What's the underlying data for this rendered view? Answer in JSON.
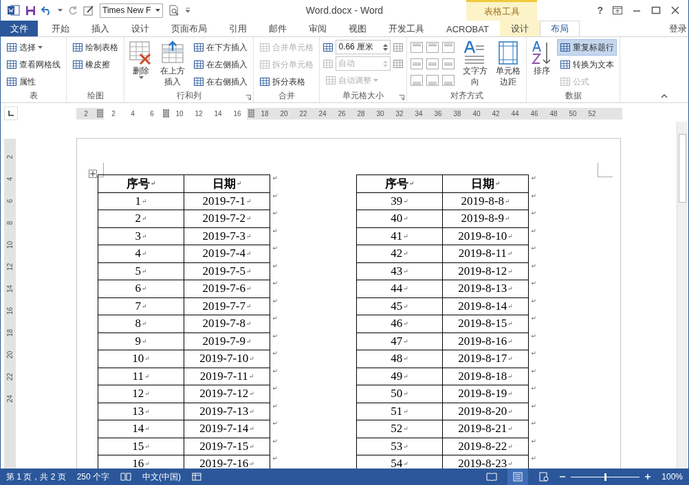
{
  "window": {
    "title": "Word.docx - Word",
    "help": "?",
    "sign_in": "登录",
    "contextual_header": "表格工具"
  },
  "quick_access": {
    "font": "Times New F"
  },
  "tabs": [
    {
      "label": "文件",
      "kind": "file",
      "selected": false
    },
    {
      "label": "开始",
      "kind": "normal",
      "selected": false
    },
    {
      "label": "插入",
      "kind": "normal",
      "selected": false
    },
    {
      "label": "设计",
      "kind": "normal",
      "selected": false
    },
    {
      "label": "页面布局",
      "kind": "normal",
      "selected": false
    },
    {
      "label": "引用",
      "kind": "normal",
      "selected": false
    },
    {
      "label": "邮件",
      "kind": "normal",
      "selected": false
    },
    {
      "label": "审阅",
      "kind": "normal",
      "selected": false
    },
    {
      "label": "视图",
      "kind": "normal",
      "selected": false
    },
    {
      "label": "开发工具",
      "kind": "normal",
      "selected": false
    },
    {
      "label": "ACROBAT",
      "kind": "normal",
      "selected": false
    },
    {
      "label": "设计",
      "kind": "context",
      "selected": false
    },
    {
      "label": "布局",
      "kind": "context",
      "selected": true
    }
  ],
  "ribbon": [
    {
      "label": "表",
      "launcher": false,
      "items": [
        {
          "kind": "stack",
          "buttons": [
            {
              "label": "选择",
              "dropdown": true,
              "disabled": false,
              "selected": false
            },
            {
              "label": "查看网格线",
              "dropdown": false,
              "disabled": false,
              "selected": false
            },
            {
              "label": "属性",
              "dropdown": false,
              "disabled": false,
              "selected": false
            }
          ]
        }
      ]
    },
    {
      "label": "绘图",
      "launcher": false,
      "items": [
        {
          "kind": "stack",
          "buttons": [
            {
              "label": "绘制表格",
              "dropdown": false,
              "disabled": false,
              "selected": false
            },
            {
              "label": "橡皮擦",
              "dropdown": false,
              "disabled": false,
              "selected": false
            }
          ]
        }
      ]
    },
    {
      "label": "行和列",
      "launcher": true,
      "items": [
        {
          "kind": "large",
          "label": "删除",
          "dropdown": true
        },
        {
          "kind": "large",
          "label": "在上方插入",
          "dropdown": false
        },
        {
          "kind": "stack",
          "buttons": [
            {
              "label": "在下方插入",
              "dropdown": false,
              "disabled": false,
              "selected": false
            },
            {
              "label": "在左侧插入",
              "dropdown": false,
              "disabled": false,
              "selected": false
            },
            {
              "label": "在右侧插入",
              "dropdown": false,
              "disabled": false,
              "selected": false
            }
          ]
        }
      ]
    },
    {
      "label": "合并",
      "launcher": false,
      "items": [
        {
          "kind": "stack",
          "buttons": [
            {
              "label": "合并单元格",
              "dropdown": false,
              "disabled": true,
              "selected": false
            },
            {
              "label": "拆分单元格",
              "dropdown": false,
              "disabled": true,
              "selected": false
            },
            {
              "label": "拆分表格",
              "dropdown": false,
              "disabled": false,
              "selected": false
            }
          ]
        }
      ]
    },
    {
      "label": "单元格大小",
      "launcher": true,
      "items": [
        {
          "kind": "sizes",
          "height": "0.66 厘米",
          "width": "自动",
          "width_disabled": true,
          "autofit": "自动调整",
          "autofit_disabled": true
        }
      ]
    },
    {
      "label": "对齐方式",
      "launcher": false,
      "items": [
        {
          "kind": "align"
        },
        {
          "kind": "large",
          "label": "文字方向",
          "dropdown": false
        },
        {
          "kind": "large",
          "label": "单元格边距",
          "dropdown": false
        }
      ]
    },
    {
      "label": "数据",
      "launcher": false,
      "items": [
        {
          "kind": "large",
          "label": "排序",
          "dropdown": false
        },
        {
          "kind": "stack",
          "buttons": [
            {
              "label": "重复标题行",
              "dropdown": false,
              "disabled": false,
              "selected": true
            },
            {
              "label": "转换为文本",
              "dropdown": false,
              "disabled": false,
              "selected": false
            },
            {
              "label": "公式",
              "dropdown": false,
              "disabled": true,
              "selected": false
            }
          ]
        }
      ]
    }
  ],
  "ruler": [
    {
      "kind": "num",
      "text": "2",
      "margin": true
    },
    {
      "kind": "marker",
      "margin": true
    },
    {
      "kind": "num",
      "text": "2",
      "margin": false
    },
    {
      "kind": "num",
      "text": "4",
      "margin": false
    },
    {
      "kind": "num",
      "text": "6",
      "margin": false
    },
    {
      "kind": "marker",
      "margin": false
    },
    {
      "kind": "num",
      "text": "10",
      "margin": false
    },
    {
      "kind": "num",
      "text": "12",
      "margin": false
    },
    {
      "kind": "num",
      "text": "14",
      "margin": false
    },
    {
      "kind": "num",
      "text": "16",
      "margin": false
    },
    {
      "kind": "marker",
      "margin": true
    },
    {
      "kind": "num",
      "text": "18",
      "margin": true
    },
    {
      "kind": "num",
      "text": "20",
      "margin": true
    },
    {
      "kind": "num",
      "text": "22",
      "margin": true
    },
    {
      "kind": "num",
      "text": "24",
      "margin": true
    },
    {
      "kind": "num",
      "text": "26",
      "margin": true
    },
    {
      "kind": "num",
      "text": "28",
      "margin": true
    },
    {
      "kind": "num",
      "text": "30",
      "margin": true
    },
    {
      "kind": "num",
      "text": "32",
      "margin": true
    },
    {
      "kind": "num",
      "text": "34",
      "margin": true
    },
    {
      "kind": "num",
      "text": "36",
      "margin": true
    },
    {
      "kind": "num",
      "text": "38",
      "margin": true
    },
    {
      "kind": "num",
      "text": "40",
      "margin": true
    },
    {
      "kind": "num",
      "text": "42",
      "margin": true
    },
    {
      "kind": "num",
      "text": "44",
      "margin": true
    },
    {
      "kind": "num",
      "text": "46",
      "margin": true
    },
    {
      "kind": "num",
      "text": "48",
      "margin": true
    },
    {
      "kind": "num",
      "text": "50",
      "margin": true
    },
    {
      "kind": "num",
      "text": "52",
      "margin": true
    }
  ],
  "vertical_ruler": [
    "2",
    "4",
    "6",
    "8",
    "10",
    "12",
    "14",
    "16",
    "18",
    "20",
    "22",
    "24"
  ],
  "tables": [
    {
      "header": [
        {
          "text": "序号",
          "mark": "↵"
        },
        {
          "text": "日期",
          "mark": "↵"
        }
      ],
      "header_end": "↵",
      "rows": [
        {
          "cells": [
            {
              "text": "1",
              "mark": "↵"
            },
            {
              "text": "2019-7-1",
              "mark": "↵"
            }
          ],
          "end": "↵"
        },
        {
          "cells": [
            {
              "text": "2",
              "mark": "↵"
            },
            {
              "text": "2019-7-2",
              "mark": "↵"
            }
          ],
          "end": "↵"
        },
        {
          "cells": [
            {
              "text": "3",
              "mark": "↵"
            },
            {
              "text": "2019-7-3",
              "mark": "↵"
            }
          ],
          "end": "↵"
        },
        {
          "cells": [
            {
              "text": "4",
              "mark": "↵"
            },
            {
              "text": "2019-7-4",
              "mark": "↵"
            }
          ],
          "end": "↵"
        },
        {
          "cells": [
            {
              "text": "5",
              "mark": "↵"
            },
            {
              "text": "2019-7-5",
              "mark": "↵"
            }
          ],
          "end": "↵"
        },
        {
          "cells": [
            {
              "text": "6",
              "mark": "↵"
            },
            {
              "text": "2019-7-6",
              "mark": "↵"
            }
          ],
          "end": "↵"
        },
        {
          "cells": [
            {
              "text": "7",
              "mark": "↵"
            },
            {
              "text": "2019-7-7",
              "mark": "↵"
            }
          ],
          "end": "↵"
        },
        {
          "cells": [
            {
              "text": "8",
              "mark": "↵"
            },
            {
              "text": "2019-7-8",
              "mark": "↵"
            }
          ],
          "end": "↵"
        },
        {
          "cells": [
            {
              "text": "9",
              "mark": "↵"
            },
            {
              "text": "2019-7-9",
              "mark": "↵"
            }
          ],
          "end": "↵"
        },
        {
          "cells": [
            {
              "text": "10",
              "mark": "↵"
            },
            {
              "text": "2019-7-10",
              "mark": "↵"
            }
          ],
          "end": "↵"
        },
        {
          "cells": [
            {
              "text": "11",
              "mark": "↵"
            },
            {
              "text": "2019-7-11",
              "mark": "↵"
            }
          ],
          "end": "↵"
        },
        {
          "cells": [
            {
              "text": "12",
              "mark": "↵"
            },
            {
              "text": "2019-7-12",
              "mark": "↵"
            }
          ],
          "end": "↵"
        },
        {
          "cells": [
            {
              "text": "13",
              "mark": "↵"
            },
            {
              "text": "2019-7-13",
              "mark": "↵"
            }
          ],
          "end": "↵"
        },
        {
          "cells": [
            {
              "text": "14",
              "mark": "↵"
            },
            {
              "text": "2019-7-14",
              "mark": "↵"
            }
          ],
          "end": "↵"
        },
        {
          "cells": [
            {
              "text": "15",
              "mark": "↵"
            },
            {
              "text": "2019-7-15",
              "mark": "↵"
            }
          ],
          "end": "↵"
        },
        {
          "cells": [
            {
              "text": "16",
              "mark": "↵"
            },
            {
              "text": "2019-7-16",
              "mark": "↵"
            }
          ],
          "end": "↵"
        }
      ]
    },
    {
      "header": [
        {
          "text": "序号",
          "mark": "↵"
        },
        {
          "text": "日期",
          "mark": "↵"
        }
      ],
      "header_end": "↵",
      "rows": [
        {
          "cells": [
            {
              "text": "39",
              "mark": "↵"
            },
            {
              "text": "2019-8-8",
              "mark": "↵"
            }
          ],
          "end": "↵"
        },
        {
          "cells": [
            {
              "text": "40",
              "mark": "↵"
            },
            {
              "text": "2019-8-9",
              "mark": "↵"
            }
          ],
          "end": "↵"
        },
        {
          "cells": [
            {
              "text": "41",
              "mark": "↵"
            },
            {
              "text": "2019-8-10",
              "mark": "↵"
            }
          ],
          "end": "↵"
        },
        {
          "cells": [
            {
              "text": "42",
              "mark": "↵"
            },
            {
              "text": "2019-8-11",
              "mark": "↵"
            }
          ],
          "end": "↵"
        },
        {
          "cells": [
            {
              "text": "43",
              "mark": "↵"
            },
            {
              "text": "2019-8-12",
              "mark": "↵"
            }
          ],
          "end": "↵"
        },
        {
          "cells": [
            {
              "text": "44",
              "mark": "↵"
            },
            {
              "text": "2019-8-13",
              "mark": "↵"
            }
          ],
          "end": "↵"
        },
        {
          "cells": [
            {
              "text": "45",
              "mark": "↵"
            },
            {
              "text": "2019-8-14",
              "mark": "↵"
            }
          ],
          "end": "↵"
        },
        {
          "cells": [
            {
              "text": "46",
              "mark": "↵"
            },
            {
              "text": "2019-8-15",
              "mark": "↵"
            }
          ],
          "end": "↵"
        },
        {
          "cells": [
            {
              "text": "47",
              "mark": "↵"
            },
            {
              "text": "2019-8-16",
              "mark": "↵"
            }
          ],
          "end": "↵"
        },
        {
          "cells": [
            {
              "text": "48",
              "mark": "↵"
            },
            {
              "text": "2019-8-17",
              "mark": "↵"
            }
          ],
          "end": "↵"
        },
        {
          "cells": [
            {
              "text": "49",
              "mark": "↵"
            },
            {
              "text": "2019-8-18",
              "mark": "↵"
            }
          ],
          "end": "↵"
        },
        {
          "cells": [
            {
              "text": "50",
              "mark": "↵"
            },
            {
              "text": "2019-8-19",
              "mark": "↵"
            }
          ],
          "end": "↵"
        },
        {
          "cells": [
            {
              "text": "51",
              "mark": "↵"
            },
            {
              "text": "2019-8-20",
              "mark": "↵"
            }
          ],
          "end": "↵"
        },
        {
          "cells": [
            {
              "text": "52",
              "mark": "↵"
            },
            {
              "text": "2019-8-21",
              "mark": "↵"
            }
          ],
          "end": "↵"
        },
        {
          "cells": [
            {
              "text": "53",
              "mark": "↵"
            },
            {
              "text": "2019-8-22",
              "mark": "↵"
            }
          ],
          "end": "↵"
        },
        {
          "cells": [
            {
              "text": "54",
              "mark": "↵"
            },
            {
              "text": "2019-8-23",
              "mark": "↵"
            }
          ],
          "end": "↵"
        }
      ]
    }
  ],
  "status_bar": {
    "page": "第 1 页，共 2 页",
    "words": "250 个字",
    "language": "中文(中国)",
    "views": [
      {
        "kind": "read",
        "selected": false
      },
      {
        "kind": "print",
        "selected": true
      },
      {
        "kind": "web",
        "selected": false
      }
    ],
    "zoom_slider": {
      "level": 0.5
    },
    "zoom": "100%"
  }
}
